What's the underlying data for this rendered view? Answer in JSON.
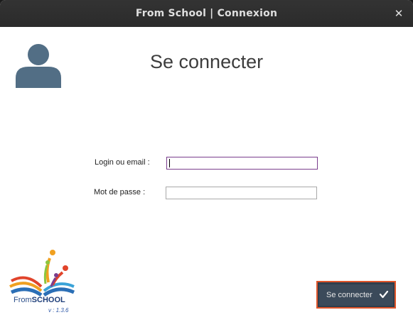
{
  "window": {
    "title": "From School | Connexion",
    "close_glyph": "✕",
    "close_icon": "close-icon"
  },
  "main": {
    "heading": "Se connecter",
    "avatar_icon": "user-avatar-icon"
  },
  "form": {
    "login_label": "Login ou email :",
    "login_value": "",
    "password_label": "Mot de passe :",
    "password_value": ""
  },
  "branding": {
    "logo_from": "From",
    "logo_school": "SCHOOL",
    "version": "v : 1.3.6"
  },
  "actions": {
    "submit_label": "Se connecter",
    "submit_icon": "checkmark-icon"
  },
  "colors": {
    "titlebar": "#2b2b2b",
    "avatar": "#526e85",
    "button_bg": "#3b4a5a",
    "button_border": "#e0552a",
    "login_focus_border": "#7a3d8c"
  }
}
